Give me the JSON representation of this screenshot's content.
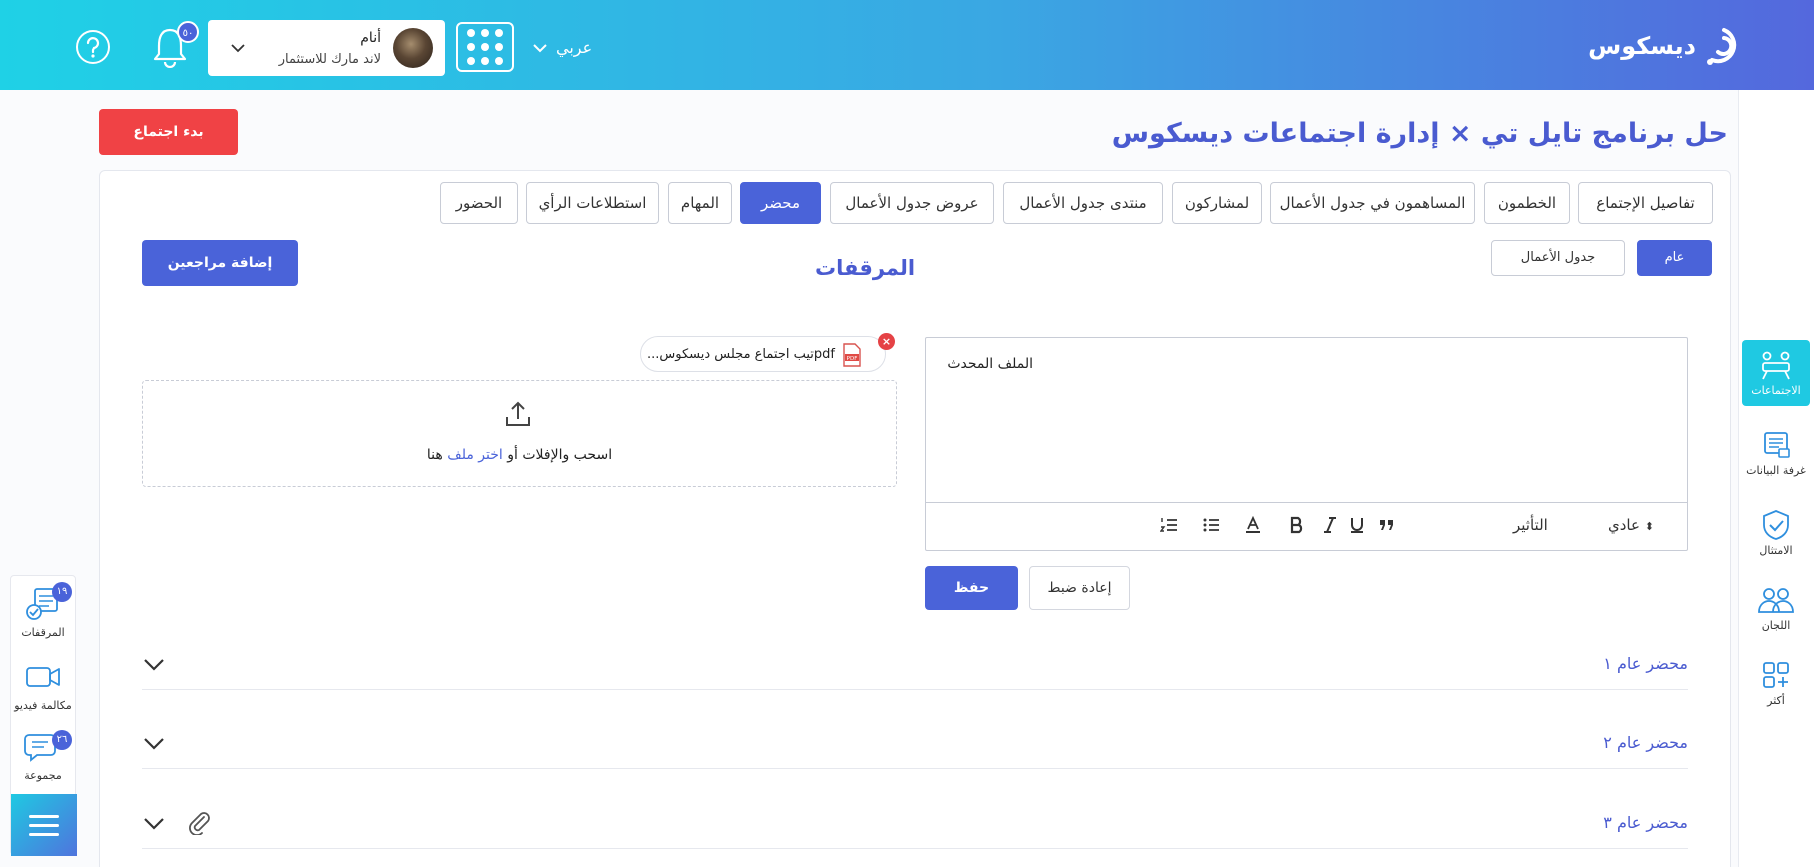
{
  "header": {
    "logo_text": "ديسكوس",
    "language": "عربي",
    "notification_count": "٥٠",
    "user_name": "أنام",
    "user_org": "لاند مارك للاستثمار"
  },
  "right_nav": [
    {
      "label": "الاجتماعات",
      "icon": "meetings-icon"
    },
    {
      "label": "غرفة البيانات",
      "icon": "data-room-icon"
    },
    {
      "label": "الامتثال",
      "icon": "compliance-icon"
    },
    {
      "label": "اللجان",
      "icon": "committees-icon"
    },
    {
      "label": "أكثر",
      "icon": "more-icon"
    }
  ],
  "left_bar": {
    "attachments_label": "المرقفات",
    "attachments_count": "١٩",
    "video_label": "مكالمة فيديو",
    "group_label": "مجموعة",
    "group_count": "٢٦"
  },
  "page": {
    "title": "حل برنامج تايل تي × إدارة اجتماعات ديسكوس",
    "start_meeting": "بدء اجتماع"
  },
  "tabs": [
    {
      "label": "تفاصيل الإجتماع"
    },
    {
      "label": "الخطمون"
    },
    {
      "label": "المساهمون في جدول الأعمال"
    },
    {
      "label": "لمشاركون"
    },
    {
      "label": "منتدى جدول الأعمال"
    },
    {
      "label": "عروض جدول الأعمال"
    },
    {
      "label": "محضر"
    },
    {
      "label": "المهام"
    },
    {
      "label": "استطلاعات الرأي"
    },
    {
      "label": "الحضور"
    }
  ],
  "minutes": {
    "general_tab": "عام",
    "agenda_tab": "جدول الأعمال",
    "attachments_heading": "المرقفات",
    "add_reviewers": "إضافة مراجعين",
    "editor_content": "الملف المحدث",
    "toolbar_style": "عادي",
    "toolbar_effect": "التأثير",
    "save": "حفظ",
    "reset": "إعادة ضبط",
    "file_name": "pdfتيب اجتماع مجلس ديسكوس...",
    "drop_text_before": "اسحب والإفلات أو ",
    "drop_link": "اختر ملف",
    "drop_text_after": " هنا"
  },
  "accordion": [
    {
      "title": "محضر عام ١"
    },
    {
      "title": "محضر عام ٢"
    },
    {
      "title": "محضر عام ٣"
    }
  ],
  "colors": {
    "primary": "#4a63d9",
    "danger": "#f04245",
    "accent": "#1fc9e2"
  }
}
